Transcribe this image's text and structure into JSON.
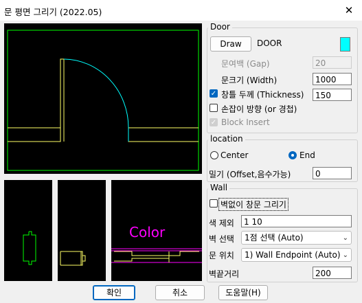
{
  "window": {
    "title": "문 평면 그리기 (2022.05)",
    "close_glyph": "✕"
  },
  "door": {
    "group_label": "Door",
    "draw_button": "Draw",
    "door_name": "DOOR",
    "swatch_color": "#00ffff",
    "gap_label": "문여백 (Gap)",
    "gap_value": "20",
    "width_label": "문크기 (Width)",
    "width_value": "1000",
    "thickness_label": "창틀 두께 (Thickness)",
    "thickness_value": "150",
    "thickness_checked": true,
    "handle_label": "손잡이 방향 (or 경첩)",
    "handle_checked": false,
    "block_label": "Block Insert",
    "block_checked": true
  },
  "location": {
    "group_label": "location",
    "center_label": "Center",
    "end_label": "End",
    "selected": "End",
    "offset_label": "밀기 (Offset,음수가능)",
    "offset_value": "0"
  },
  "wall": {
    "group_label": "Wall",
    "no_wall_label": "벽없이 창문 그리기",
    "no_wall_checked": false,
    "color_label": "색 제외",
    "color_value": "1 10",
    "wall_select_label": "벽 선택",
    "wall_select_value": "1점 선택 (Auto)",
    "door_pos_label": "문 위치",
    "door_pos_value": "1) Wall Endpoint (Auto)",
    "wall_end_label": "벽끝거리",
    "wall_end_value": "200"
  },
  "preview": {
    "color_text": "Color"
  },
  "buttons": {
    "ok": "확인",
    "cancel": "취소",
    "help": "도움말(H)"
  },
  "colors": {
    "accent": "#0067c0",
    "preview_bg": "#000000",
    "cyan": "#00ffff",
    "yellow": "#ffff66",
    "green": "#00ff00",
    "magenta": "#ff00ff"
  },
  "icons": {
    "chevron": "chevron-down-icon",
    "check": "check-icon"
  }
}
